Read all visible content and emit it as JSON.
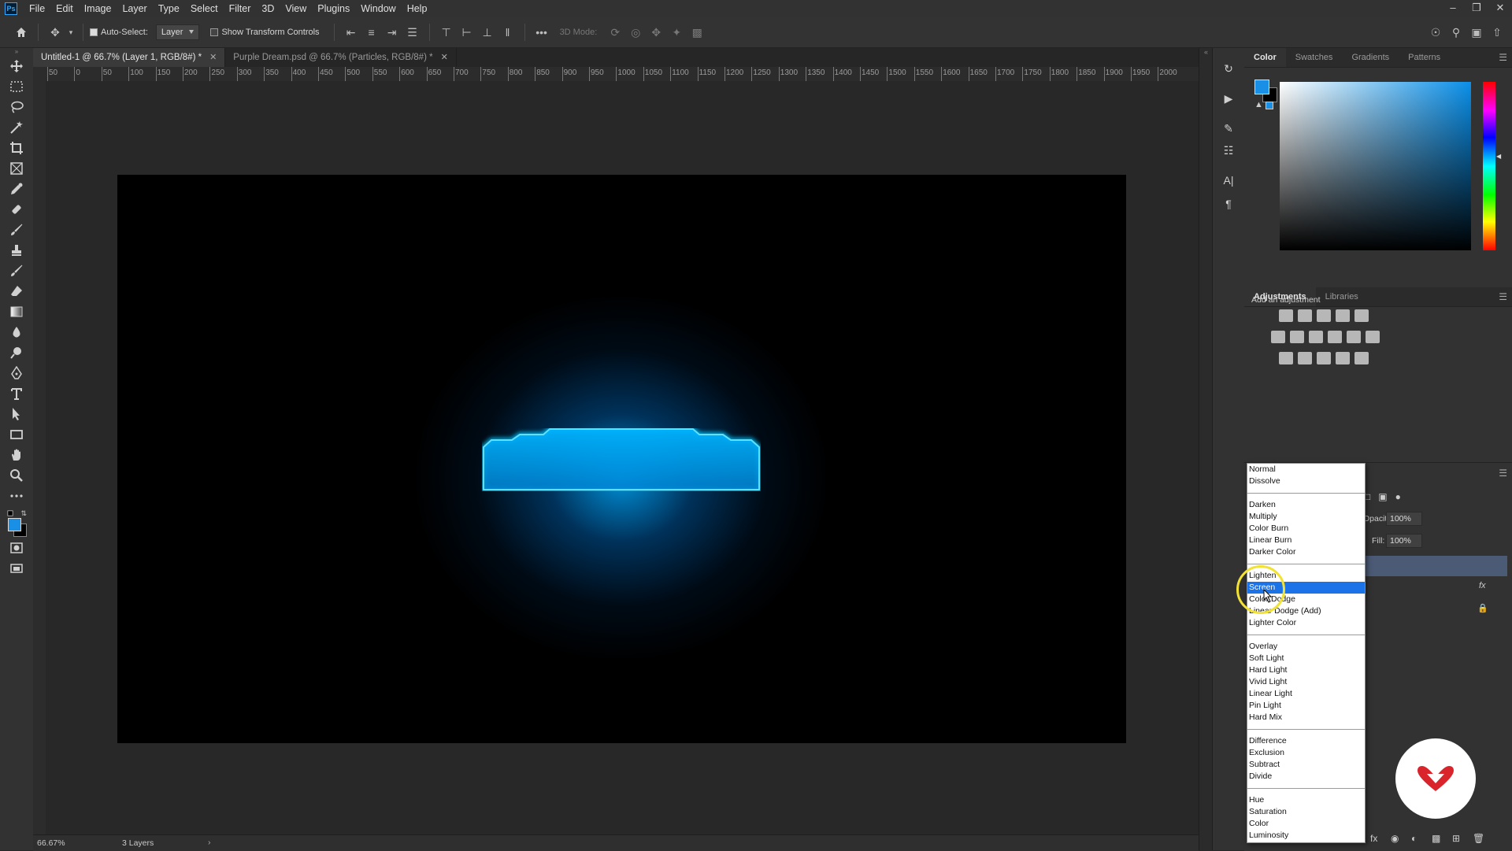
{
  "menubar": {
    "logo": "Ps",
    "items": [
      "File",
      "Edit",
      "Image",
      "Layer",
      "Type",
      "Select",
      "Filter",
      "3D",
      "View",
      "Plugins",
      "Window",
      "Help"
    ]
  },
  "options": {
    "auto_select_label": "Auto-Select:",
    "auto_select_value": "Layer",
    "show_transform_label": "Show Transform Controls",
    "mode_3d_label": "3D Mode:"
  },
  "tabs": [
    {
      "label": "Untitled-1 @ 66.7% (Layer 1, RGB/8#) *"
    },
    {
      "label": "Purple Dream.psd @ 66.7% (Particles, RGB/8#) *"
    }
  ],
  "ruler": {
    "h_ticks": [
      "50",
      "0",
      "50",
      "100",
      "150",
      "200",
      "250",
      "300",
      "350",
      "400",
      "450",
      "500",
      "550",
      "600",
      "650",
      "700",
      "750",
      "800",
      "850",
      "900",
      "950",
      "1000",
      "1050",
      "1100",
      "1150",
      "1200",
      "1250",
      "1300",
      "1350",
      "1400",
      "1450",
      "1500",
      "1550",
      "1600",
      "1650",
      "1700",
      "1750",
      "1800",
      "1850",
      "1900",
      "1950",
      "2000"
    ]
  },
  "status": {
    "zoom": "66.67%",
    "info": "3 Layers"
  },
  "color_panel": {
    "tabs": [
      "Color",
      "Swatches",
      "Gradients",
      "Patterns"
    ],
    "foreground": "#1a8fe6",
    "background": "#000000"
  },
  "adjustments_panel": {
    "tabs": [
      "Adjustments",
      "Libraries"
    ],
    "hint": "Add an adjustment"
  },
  "layers_panel": {
    "opacity_label": "Opacity:",
    "opacity_value": "100%",
    "fill_label": "Fill:",
    "fill_value": "100%"
  },
  "blend_modes": {
    "groups": [
      [
        "Normal",
        "Dissolve"
      ],
      [
        "Darken",
        "Multiply",
        "Color Burn",
        "Linear Burn",
        "Darker Color"
      ],
      [
        "Lighten",
        "Screen",
        "Color Dodge",
        "Linear Dodge (Add)",
        "Lighter Color"
      ],
      [
        "Overlay",
        "Soft Light",
        "Hard Light",
        "Vivid Light",
        "Linear Light",
        "Pin Light",
        "Hard Mix"
      ],
      [
        "Difference",
        "Exclusion",
        "Subtract",
        "Divide"
      ],
      [
        "Hue",
        "Saturation",
        "Color",
        "Luminosity"
      ]
    ],
    "selected": "Screen"
  },
  "accent_colors": {
    "selection": "#1c73e8",
    "glow": "#00aaff",
    "cursor_ring": "#f2e233",
    "badge": "#d9242b"
  }
}
